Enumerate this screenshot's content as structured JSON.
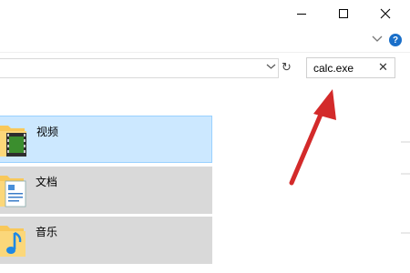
{
  "window": {
    "minimize_icon": "minimize-icon",
    "maximize_icon": "maximize-icon",
    "close_icon": "close-icon"
  },
  "ribbon": {
    "collapse_icon": "chevron-down-icon",
    "help_label": "?"
  },
  "address": {
    "dropdown_icon": "chevron-down-icon",
    "refresh_icon": "refresh-icon",
    "refresh_glyph": "↻"
  },
  "search": {
    "value": "calc.exe",
    "clear_glyph": "✕"
  },
  "items": [
    {
      "label": "视频",
      "icon": "video-folder-icon",
      "selected": true
    },
    {
      "label": "文档",
      "icon": "documents-folder-icon",
      "selected": false
    },
    {
      "label": "音乐",
      "icon": "music-folder-icon",
      "selected": false
    }
  ],
  "colors": {
    "selected_bg": "#cce8ff",
    "selected_border": "#99d1ff",
    "item_bg": "#d9d9d9",
    "arrow": "#d32a2a",
    "folder": "#f8c85a",
    "help": "#1a6fc9"
  }
}
